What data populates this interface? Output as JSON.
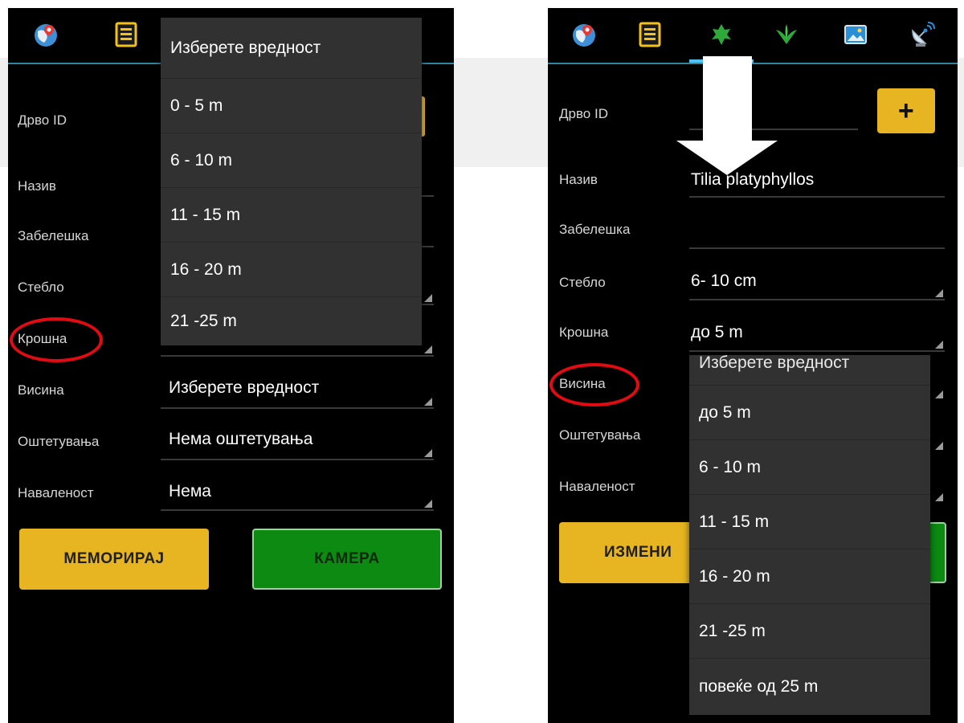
{
  "colors": {
    "accent_blue": "#2f86a3",
    "yellow": "#e6b521",
    "green": "#0c8a12",
    "highlight_red": "#e20b12"
  },
  "left": {
    "fields": {
      "tree_id": "Дрво ID",
      "name": "Назив",
      "note": "Забелешка",
      "trunk": "Стебло",
      "crown": "Крошна",
      "height": "Висина",
      "damage": "Оштетувања",
      "infestation": "Нaваленост"
    },
    "values": {
      "height": "Изберете вредност",
      "damage": "Нема оштетувања",
      "infestation": "Нема"
    },
    "dropdown": {
      "header": "Изберете вредност",
      "options": [
        "0 - 5 m",
        "6 - 10 m",
        "11 - 15 m",
        "16 - 20 m",
        "21 -25 m"
      ]
    },
    "buttons": {
      "save": "МЕМОРИРАЈ",
      "camera": "КАМЕРА"
    }
  },
  "right": {
    "fields": {
      "tree_id": "Дрво ID",
      "name": "Назив",
      "note": "Забелешка",
      "trunk": "Стебло",
      "crown": "Крошна",
      "height": "Висина",
      "damage": "Оштетувања",
      "infestation": "Нaваленост"
    },
    "values": {
      "name": "Tilia platyphyllos",
      "trunk": "6- 10 cm",
      "crown": "до 5 m"
    },
    "add_button": "+",
    "dropdown": {
      "header": "Изберете вредност",
      "options": [
        "до 5 m",
        "6 - 10 m",
        "11 - 15 m",
        "16 - 20 m",
        "21 -25 m",
        "повеќе од 25 m"
      ]
    },
    "buttons": {
      "edit": "ИЗМЕНИ"
    }
  }
}
